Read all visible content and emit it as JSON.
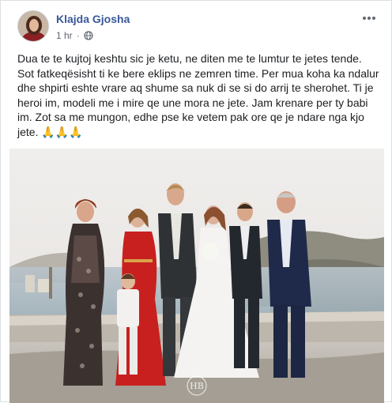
{
  "post": {
    "author": "Klajda Gjosha",
    "time": "1 hr",
    "separator": "·",
    "audience_icon": "globe-icon",
    "more_icon": "more-options-icon",
    "text": "Dua te te kujtoj keshtu sic je ketu, ne diten me te lumtur te jetes tende.\nSot fatkeqësisht ti ke bere eklips ne zemren time. Per mua koha ka ndalur dhe shpirti eshte vrare aq shume sa nuk di se si do arrij te sherohet. Ti je heroi im, modeli me i mire qe une mora ne jete. Jam krenare per ty babi im. Zot sa me mungon, edhe pse ke vetem pak ore qe je ndare nga kjo jete. 🙏🙏🙏"
  },
  "photo": {
    "watermark": "HB"
  },
  "colors": {
    "author_link": "#385898",
    "meta_gray": "#616770",
    "border": "#dddfe2"
  }
}
